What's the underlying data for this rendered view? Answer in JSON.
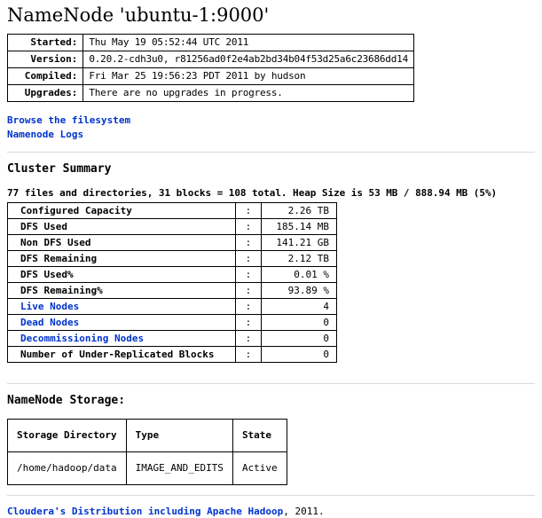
{
  "page": {
    "title": "NameNode 'ubuntu-1:9000'",
    "link_color": "#0033cc",
    "hr_color": "#d9d9d9"
  },
  "info": {
    "rows": [
      {
        "label": "Started:",
        "value": "Thu May 19 05:52:44 UTC 2011"
      },
      {
        "label": "Version:",
        "value": "0.20.2-cdh3u0, r81256ad0f2e4ab2bd34b04f53d25a6c23686dd14"
      },
      {
        "label": "Compiled:",
        "value": "Fri Mar 25 19:56:23 PDT 2011 by hudson"
      },
      {
        "label": "Upgrades:",
        "value": "There are no upgrades in progress."
      }
    ]
  },
  "nav": {
    "browse_filesystem": "Browse the filesystem",
    "namenode_logs": "Namenode Logs"
  },
  "cluster_summary": {
    "heading": "Cluster Summary",
    "summary_line": "77 files and directories, 31 blocks = 108 total. Heap Size is 53 MB / 888.94 MB (5%)",
    "separator": ":",
    "rows": [
      {
        "label": "Configured Capacity",
        "value": "2.26 TB",
        "link": false
      },
      {
        "label": "DFS Used",
        "value": "185.14 MB",
        "link": false
      },
      {
        "label": "Non DFS Used",
        "value": "141.21 GB",
        "link": false
      },
      {
        "label": "DFS Remaining",
        "value": "2.12 TB",
        "link": false
      },
      {
        "label": "DFS Used%",
        "value": "0.01 %",
        "link": false
      },
      {
        "label": "DFS Remaining%",
        "value": "93.89 %",
        "link": false
      },
      {
        "label": "Live Nodes",
        "value": "4",
        "link": true
      },
      {
        "label": "Dead Nodes",
        "value": "0",
        "link": true
      },
      {
        "label": "Decommissioning Nodes",
        "value": "0",
        "link": true
      },
      {
        "label": "Number of Under-Replicated Blocks",
        "value": "0",
        "link": false
      }
    ]
  },
  "namenode_storage": {
    "heading": "NameNode Storage:",
    "columns": [
      "Storage Directory",
      "Type",
      "State"
    ],
    "rows": [
      {
        "directory": "/home/hadoop/data",
        "type": "IMAGE_AND_EDITS",
        "state": "Active"
      }
    ]
  },
  "footer": {
    "link_text": "Cloudera's Distribution including Apache Hadoop",
    "tail_text": ", 2011."
  }
}
